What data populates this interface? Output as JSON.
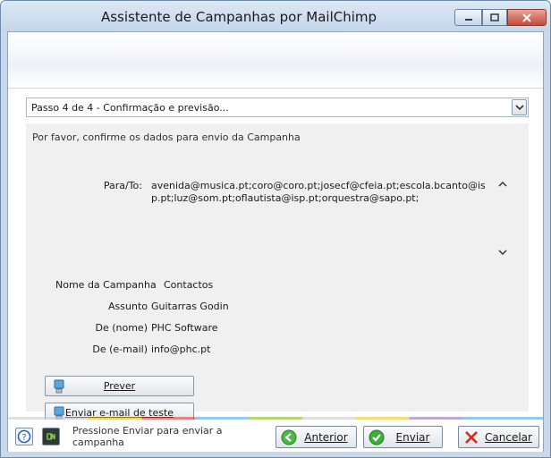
{
  "window": {
    "title": "Assistente de Campanhas por MailChimp"
  },
  "step": {
    "selected": "Passo 4 de 4 - Confirmação e previsão..."
  },
  "form": {
    "instruction": "Por favor, confirme os dados para envio da Campanha",
    "to_label": "Para/To:",
    "to_value": "avenida@musica.pt;coro@coro.pt;josecf@cfeia.pt;escola.bcanto@isp.pt;luz@som.pt;oflautista@isp.pt;orquestra@sapo.pt;",
    "campaign_name_label": "Nome da Campanha",
    "campaign_name_value": "Contactos",
    "subject_label": "Assunto",
    "subject_value": "Guitarras Godin",
    "from_name_label": "De (nome)",
    "from_name_value": "PHC Software",
    "from_email_label": "De (e-mail)",
    "from_email_value": "info@phc.pt"
  },
  "actions": {
    "preview_label": "Prever",
    "test_email_label": "Enviar e-mail de teste"
  },
  "footer": {
    "status": "Pressione Enviar para enviar a campanha",
    "back_label": "Anterior",
    "send_label": "Enviar",
    "cancel_label": "Cancelar"
  },
  "colors": {
    "accent": "#3c7fb1",
    "send_green": "#2fa12f",
    "cancel_red": "#d42a1e"
  }
}
